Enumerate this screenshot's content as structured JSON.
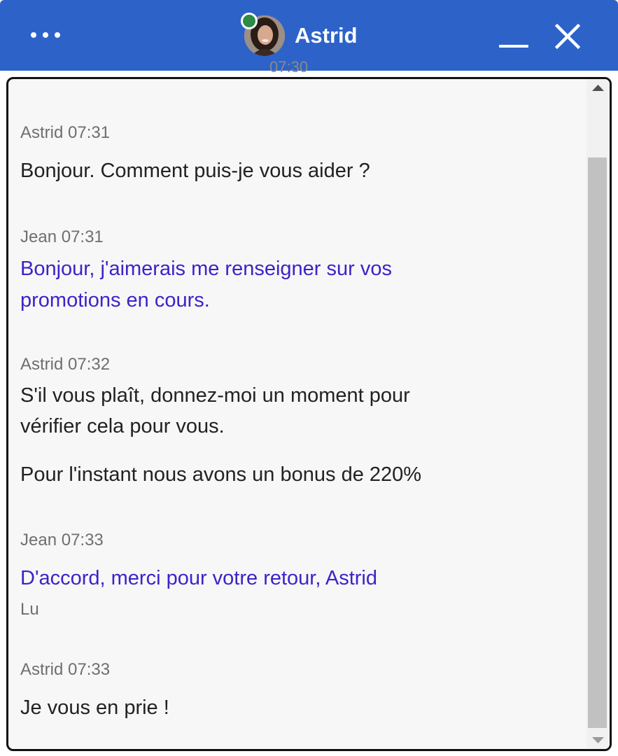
{
  "header": {
    "agent_name": "Astrid",
    "status": "online",
    "icons": {
      "menu": "more-dots-icon",
      "minimize": "minimize-icon",
      "close": "close-icon"
    }
  },
  "peek_timestamp": "07:30",
  "messages": [
    {
      "author": "Astrid",
      "time": "07:31",
      "role": "agent",
      "lines": [
        "Bonjour. Comment puis-je vous aider ?"
      ]
    },
    {
      "author": "Jean",
      "time": "07:31",
      "role": "user",
      "lines": [
        "Bonjour, j'aimerais me renseigner sur vos",
        "promotions en cours."
      ]
    },
    {
      "author": "Astrid",
      "time": "07:32",
      "role": "agent",
      "lines": [
        "S'il vous plaît, donnez-moi un moment pour",
        "vérifier cela pour vous."
      ],
      "lines_2": [
        "Pour l'instant nous avons un bonus de 220%"
      ]
    },
    {
      "author": "Jean",
      "time": "07:33",
      "role": "user",
      "lines": [
        "D'accord, merci pour votre retour, Astrid"
      ],
      "receipt": "Lu"
    },
    {
      "author": "Astrid",
      "time": "07:33",
      "role": "agent",
      "lines": [
        "Je vous en prie !"
      ]
    }
  ],
  "colors": {
    "header": "#2d63c9",
    "user_text": "#3b24c8",
    "agent_text": "#222222",
    "meta_text": "#6f6f6f",
    "online": "#2e8b46"
  }
}
